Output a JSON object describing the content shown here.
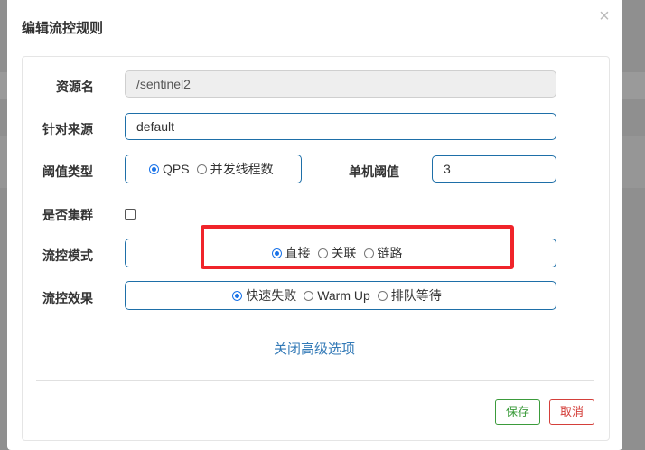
{
  "modal": {
    "title": "编辑流控规则",
    "close_icon": "×"
  },
  "form": {
    "resource_label": "资源名",
    "resource_value": "/sentinel2",
    "source_label": "针对来源",
    "source_value": "default",
    "threshold_type_label": "阈值类型",
    "threshold_type_options": [
      "QPS",
      "并发线程数"
    ],
    "threshold_type_selected": "QPS",
    "single_threshold_label": "单机阈值",
    "single_threshold_value": "3",
    "cluster_label": "是否集群",
    "cluster_checked": false,
    "mode_label": "流控模式",
    "mode_options": [
      "直接",
      "关联",
      "链路"
    ],
    "mode_selected": "直接",
    "effect_label": "流控效果",
    "effect_options": [
      "快速失败",
      "Warm Up",
      "排队等待"
    ],
    "effect_selected": "快速失败",
    "advanced_link": "关闭高级选项"
  },
  "footer": {
    "save_label": "保存",
    "cancel_label": "取消"
  },
  "colors": {
    "accent": "#1a73e8",
    "border_blue": "#1e6fa8",
    "save_green": "#3b9b3b",
    "cancel_red": "#d43f3a",
    "highlight_red": "#f0242a",
    "link_blue": "#337ab7"
  }
}
